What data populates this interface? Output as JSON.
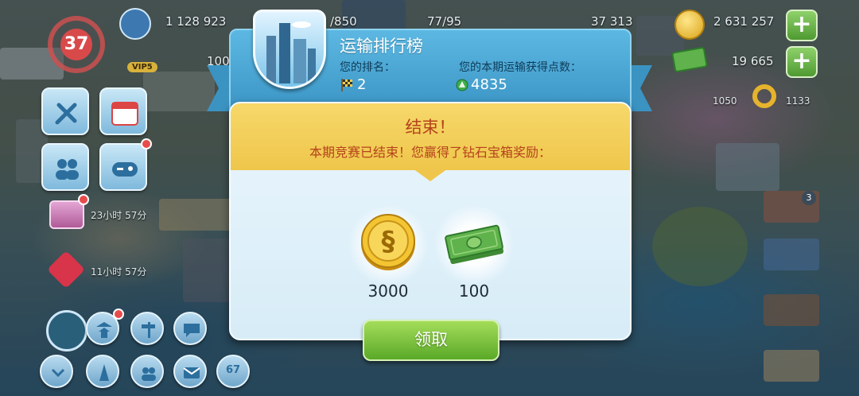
{
  "resources": {
    "simoleons": "1 128 923",
    "population_capacity": "/850",
    "storage": "77/95",
    "counter_a": "37 313",
    "simcash": "2 631 257",
    "coins_secondary": "100",
    "keys": "19 665",
    "golden_keys": "1133",
    "land": "1050"
  },
  "player": {
    "level": "37"
  },
  "side_timers": {
    "chest_timer": "23小时 57分",
    "heart_timer": "11小时 57分"
  },
  "map_badges": {
    "building_count": "3",
    "vip": "VIP5",
    "bottom_badge": "67"
  },
  "dialog": {
    "title": "运输排行榜",
    "rank_label": "您的排名：",
    "points_label": "您的本期运输获得点数：",
    "rank_value": "2",
    "points_value": "4835",
    "end_title": "结束！",
    "end_message": "本期竞赛已结束！您赢得了钻石宝箱奖励：",
    "rewards": [
      {
        "icon": "simoleon-coin-icon",
        "value": "3000"
      },
      {
        "icon": "cash-stack-icon",
        "value": "100"
      }
    ],
    "claim_label": "领取"
  },
  "colors": {
    "header_blue": "#3a93c4",
    "band_yellow": "#efc64b",
    "end_text": "#b5421b",
    "claim_green": "#5aa928"
  }
}
